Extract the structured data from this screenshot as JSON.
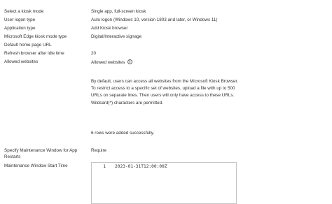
{
  "settings": [
    {
      "label": "Select a kiosk mode",
      "value": "Single app, full-screen kiosk"
    },
    {
      "label": "User logon type",
      "value": "Auto logon (Windows 10, version 1803 and later, or Windows 11)"
    },
    {
      "label": "Application type",
      "value": "Add Kiosk browser"
    },
    {
      "label": "Microsoft Edge kiosk mode type",
      "value": "Digital/Interactive signage"
    },
    {
      "label": "Default home page URL",
      "value": ""
    },
    {
      "label": "Refresh browser after idle time",
      "value": "20"
    },
    {
      "label": "Allowed websites",
      "value": "Allowed websites"
    }
  ],
  "allowed_websites_description": "By default, users can access all websites from the Microsoft Kiosk Browser. To restrict access to a specific set of websites, upload a file with up to 500 URLs on separate lines. Then users will only have access to these URLs. Wildcard(*) characters are permitted.",
  "upload_status": "6 rows were added successfully.",
  "maintenance": {
    "window_label": "Specify Maintenance Window for App Restarts",
    "window_value": "Require",
    "start_time_label": "Maintenance Window Start Time",
    "editor_line_number": "1",
    "editor_line_text": "2023-01-31T12:00:00Z"
  }
}
